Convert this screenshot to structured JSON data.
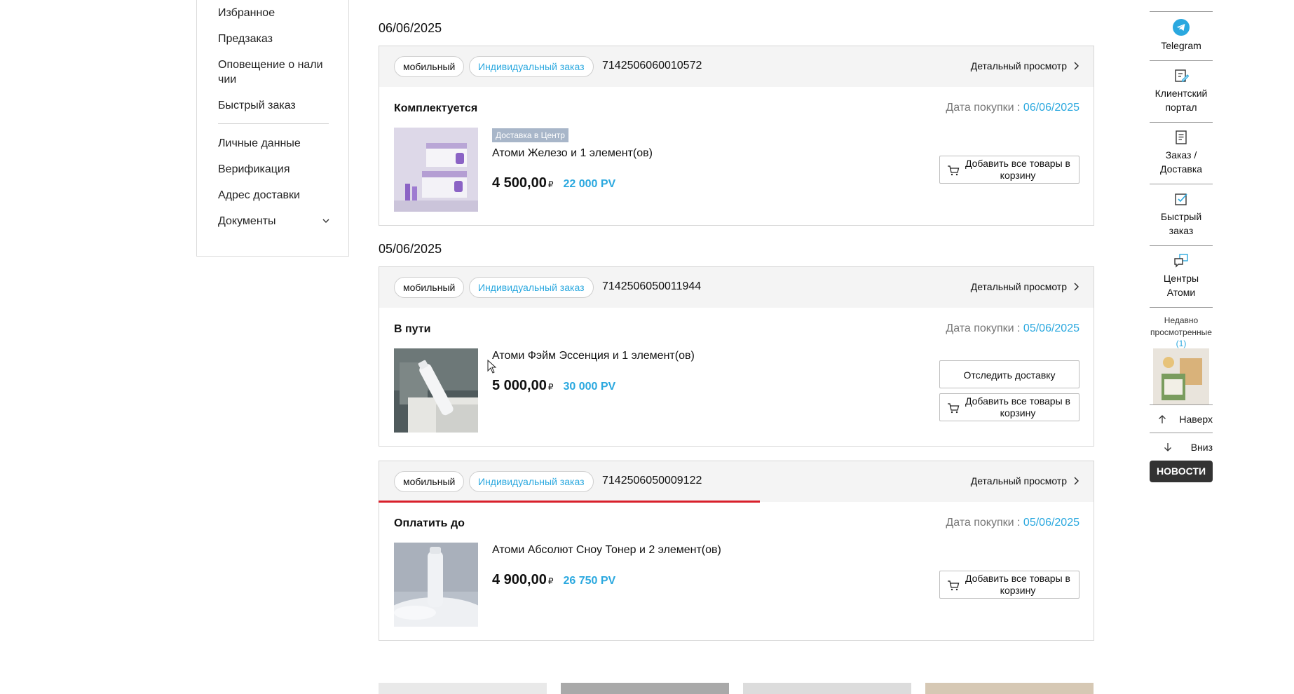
{
  "sidebar": {
    "items": [
      {
        "label": "Избранное"
      },
      {
        "label": "Предзаказ"
      },
      {
        "label": "Оповещение о нали\nчии"
      },
      {
        "label": "Быстрый заказ"
      },
      {
        "label": "Личные данные"
      },
      {
        "label": "Верификация"
      },
      {
        "label": "Адрес доставки"
      },
      {
        "label": "Документы"
      }
    ]
  },
  "orders": [
    {
      "date_heading": "06/06/2025",
      "channel": "мобильный",
      "type": "Индивидуальный заказ",
      "number": "7142506060010572",
      "detail_label": "Детальный просмотр",
      "status": "Комплектуется",
      "purchase_label": "Дата покупки : ",
      "purchase_date": "06/06/2025",
      "badge": "Доставка в Центр",
      "product": "Атоми Железо и 1 элемент(ов)",
      "price": "4 500,00",
      "currency": "₽",
      "pv": "22 000 PV",
      "cart_button": "Добавить все товары в корзину"
    },
    {
      "date_heading": "05/06/2025",
      "channel": "мобильный",
      "type": "Индивидуальный заказ",
      "number": "7142506050011944",
      "detail_label": "Детальный просмотр",
      "status": "В пути",
      "purchase_label": "Дата покупки : ",
      "purchase_date": "05/06/2025",
      "product": "Атоми Фэйм Эссенция и 1 элемент(ов)",
      "price": "5 000,00",
      "currency": "₽",
      "pv": "30 000 PV",
      "track_button": "Отследить доставку",
      "cart_button": "Добавить все товары в корзину"
    },
    {
      "channel": "мобильный",
      "type": "Индивидуальный заказ",
      "number": "7142506050009122",
      "detail_label": "Детальный просмотр",
      "status": "Оплатить до",
      "purchase_label": "Дата покупки : ",
      "purchase_date": "05/06/2025",
      "product": "Атоми Абсолют Сноу Тонер и 2 элемент(ов)",
      "price": "4 900,00",
      "currency": "₽",
      "pv": "26 750 PV",
      "cart_button": "Добавить все товары в корзину"
    }
  ],
  "quickbar": {
    "telegram": "Telegram",
    "client_portal": "Клиентский портал",
    "order_delivery": "Заказ / Доставка",
    "quick_order": "Быстрый заказ",
    "centers": "Центры Атоми",
    "recent_title": "Недавно просмотренные",
    "recent_count": "(1)",
    "up": "Наверх",
    "down": "Вниз",
    "news": "НОВОСТИ"
  },
  "colors": {
    "accent_blue": "#2aa8df",
    "telegram_blue": "#2aa8df",
    "progress_red": "#d8202b",
    "badge_bg": "#a8b6c9"
  },
  "icons": [
    "chevron-down-icon",
    "chevron-right-icon",
    "cart-icon",
    "telegram-icon",
    "edit-icon",
    "document-icon",
    "checkbox-icon",
    "chat-icon",
    "arrow-up-icon",
    "arrow-down-icon",
    "mouse-cursor-icon"
  ]
}
